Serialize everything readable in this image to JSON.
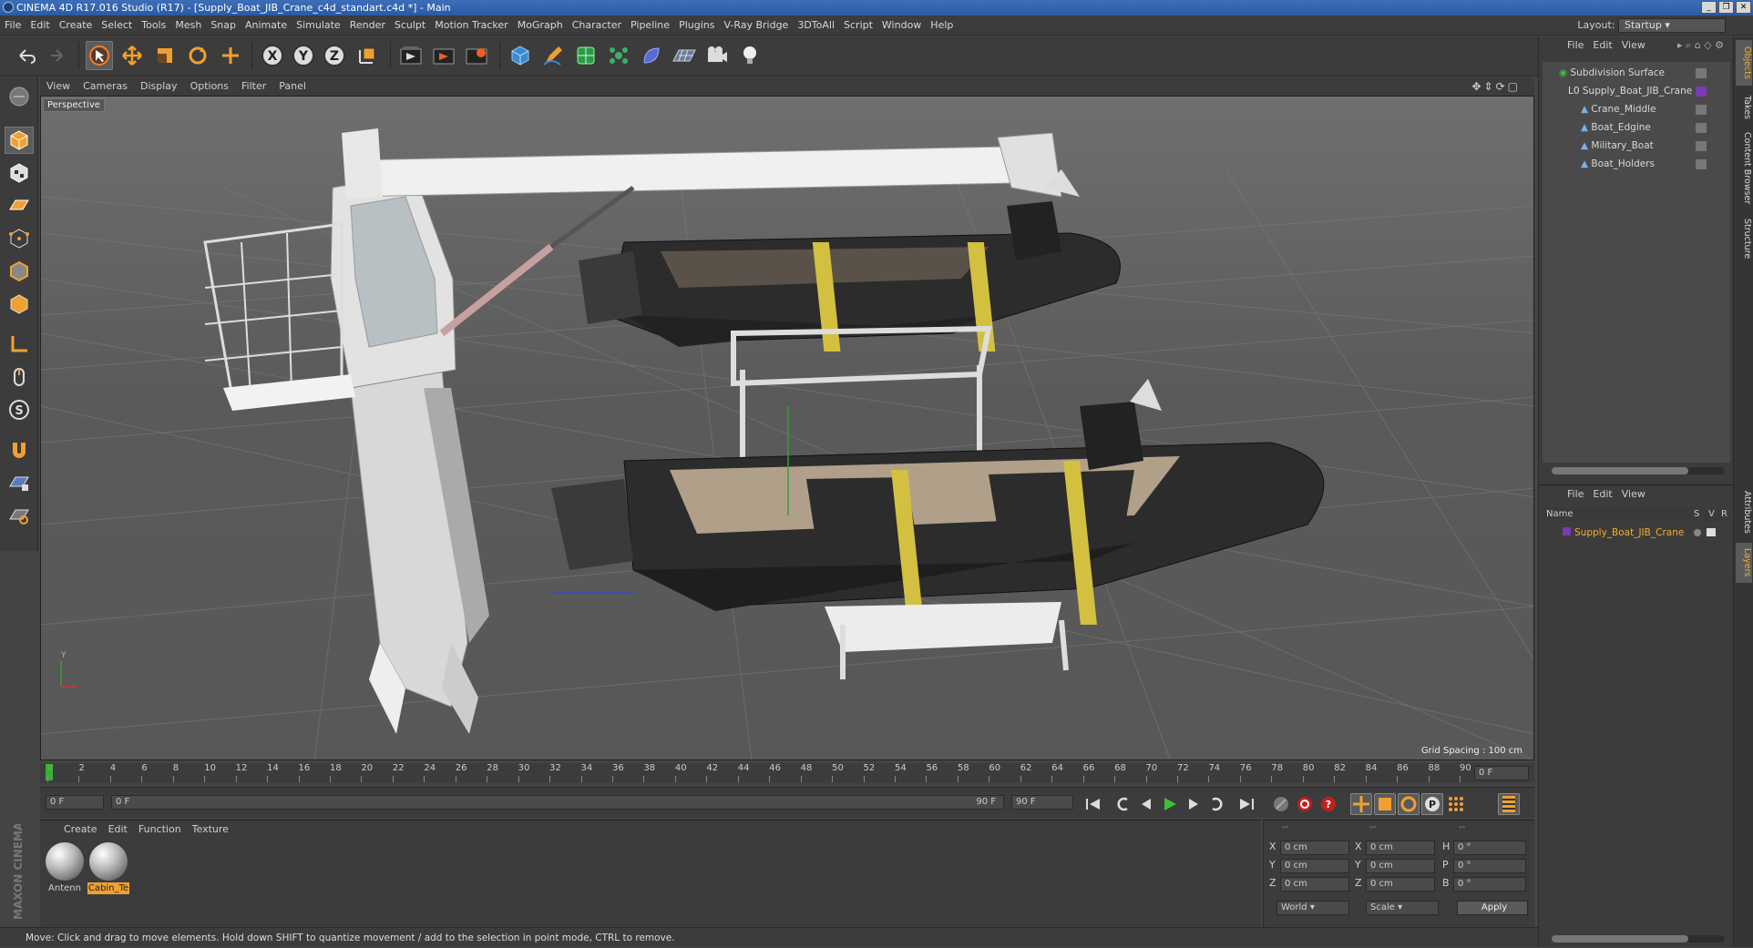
{
  "window": {
    "title": "CINEMA 4D R17.016 Studio (R17) - [Supply_Boat_JIB_Crane_c4d_standart.c4d *] - Main"
  },
  "menu": [
    "File",
    "Edit",
    "Create",
    "Select",
    "Tools",
    "Mesh",
    "Snap",
    "Animate",
    "Simulate",
    "Render",
    "Sculpt",
    "Motion Tracker",
    "MoGraph",
    "Character",
    "Pipeline",
    "Plugins",
    "V-Ray Bridge",
    "3DToAll",
    "Script",
    "Window",
    "Help"
  ],
  "layout": {
    "label": "Layout:",
    "value": "Startup"
  },
  "toolbar": {
    "icons": [
      "undo-icon",
      "redo-icon",
      "live-selection-icon",
      "move-icon",
      "scale-icon",
      "rotate-icon",
      "recent-tool-icon",
      "x-axis-icon",
      "y-axis-icon",
      "z-axis-icon",
      "coordinate-system-icon",
      "render-view-icon",
      "render-picture-viewer-icon",
      "render-settings-icon",
      "cube-icon",
      "pen-icon",
      "subdivision-icon",
      "cloner-icon",
      "deformer-icon",
      "floor-icon",
      "camera-icon",
      "light-icon"
    ],
    "axis_labels": [
      "X",
      "Y",
      "Z"
    ]
  },
  "viewport": {
    "menu": [
      "View",
      "Cameras",
      "Display",
      "Options",
      "Filter",
      "Panel"
    ],
    "label": "Perspective",
    "grid_spacing": "Grid Spacing : 100 cm",
    "axis_y": "Y"
  },
  "timeline": {
    "ticks": [
      "0",
      "2",
      "4",
      "6",
      "8",
      "10",
      "12",
      "14",
      "16",
      "18",
      "20",
      "22",
      "24",
      "26",
      "28",
      "30",
      "32",
      "34",
      "36",
      "38",
      "40",
      "42",
      "44",
      "46",
      "48",
      "50",
      "52",
      "54",
      "56",
      "58",
      "60",
      "62",
      "64",
      "66",
      "68",
      "70",
      "72",
      "74",
      "76",
      "78",
      "80",
      "82",
      "84",
      "86",
      "88",
      "90"
    ],
    "current": "0 F"
  },
  "playback": {
    "start": "0 F",
    "range_start": "0 F",
    "range_end": "90 F",
    "end": "90 F"
  },
  "materials": {
    "menu": [
      "Create",
      "Edit",
      "Function",
      "Texture"
    ],
    "items": [
      {
        "name": "Antenn"
      },
      {
        "name": "Cabin_Te"
      }
    ]
  },
  "coords": {
    "headers": [
      "--",
      "--",
      "--"
    ],
    "rows": [
      {
        "a": "X",
        "av": "0 cm",
        "b": "X",
        "bv": "0 cm",
        "c": "H",
        "cv": "0 °"
      },
      {
        "a": "Y",
        "av": "0 cm",
        "b": "Y",
        "bv": "0 cm",
        "c": "P",
        "cv": "0 °"
      },
      {
        "a": "Z",
        "av": "0 cm",
        "b": "Z",
        "bv": "0 cm",
        "c": "B",
        "cv": "0 °"
      }
    ],
    "space": "World",
    "mode": "Scale",
    "apply": "Apply"
  },
  "status": "Move: Click and drag to move elements. Hold down SHIFT to quantize movement / add to the selection in point mode, CTRL to remove.",
  "objects": {
    "menu": [
      "File",
      "Edit",
      "View"
    ],
    "items": [
      {
        "name": "Subdivision Surface"
      },
      {
        "name": "Supply_Boat_JIB_Crane"
      },
      {
        "name": "Crane_Middle"
      },
      {
        "name": "Boat_Edgine"
      },
      {
        "name": "Military_Boat"
      },
      {
        "name": "Boat_Holders"
      }
    ]
  },
  "layers": {
    "menu": [
      "File",
      "Edit",
      "View"
    ],
    "columns": {
      "name": "Name",
      "s": "S",
      "v": "V",
      "r": "R"
    },
    "items": [
      {
        "name": "Supply_Boat_JIB_Crane"
      }
    ]
  },
  "side_tabs": [
    "Objects",
    "Takes",
    "Content Browser",
    "Structure",
    "Attributes",
    "Layers"
  ],
  "branding": {
    "text": "MAXON CINEMA 4D"
  },
  "colors": {
    "accent": "#f0a030",
    "selection": "#3d6fb8",
    "layer_text": "#f0b030"
  }
}
